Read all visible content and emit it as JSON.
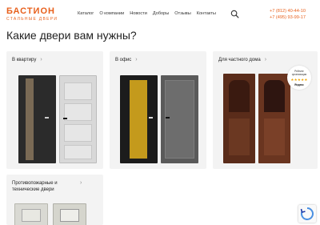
{
  "header": {
    "logo_text": "БАСТИОН",
    "logo_subtext": "СТАЛЬНЫЕ ДВЕРИ",
    "nav": [
      "Каталог",
      "О компании",
      "Новости",
      "Доборы",
      "Отзывы",
      "Контакты"
    ],
    "phones": [
      "+7 (812) 40-44-10",
      "+7 (495) 93-99-17"
    ]
  },
  "main": {
    "title": "Какие двери вам нужны?",
    "cards": [
      {
        "label": "В квартиру"
      },
      {
        "label": "В офис"
      },
      {
        "label": "Для частного дома"
      },
      {
        "label": "Противопожарные и технические двери"
      }
    ],
    "rating_badge": {
      "line1": "Рейтинг",
      "line2": "организации",
      "stars": "★★★★★",
      "brand": "Яндекс"
    }
  },
  "colors": {
    "accent": "#e8601c",
    "card_bg": "#f3f3f3"
  },
  "icons": {
    "search": "search-icon",
    "chevron": "chevron-right-icon",
    "recaptcha": "recaptcha-icon"
  }
}
